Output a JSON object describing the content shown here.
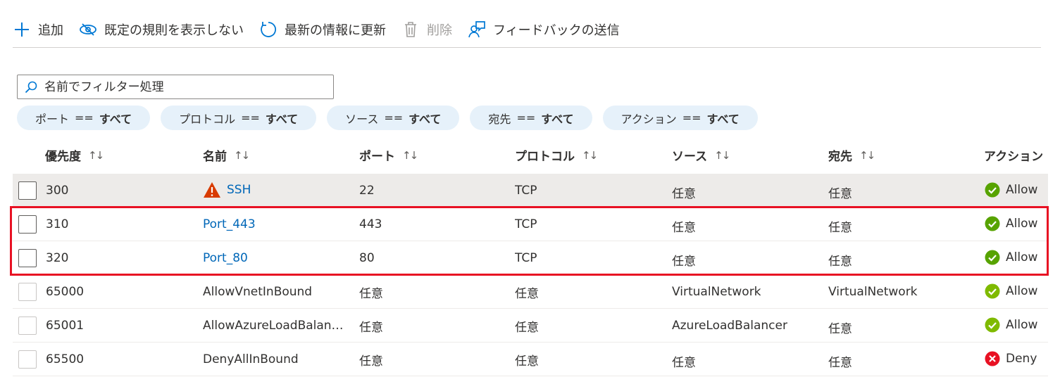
{
  "toolbar": {
    "add": "追加",
    "hide_default": "既定の規則を表示しない",
    "refresh": "最新の情報に更新",
    "delete": "削除",
    "feedback": "フィードバックの送信"
  },
  "filter": {
    "placeholder": "名前でフィルター処理"
  },
  "pills": [
    {
      "key": "ポート",
      "op": "==",
      "value": "すべて"
    },
    {
      "key": "プロトコル",
      "op": "==",
      "value": "すべて"
    },
    {
      "key": "ソース",
      "op": "==",
      "value": "すべて"
    },
    {
      "key": "宛先",
      "op": "==",
      "value": "すべて"
    },
    {
      "key": "アクション",
      "op": "==",
      "value": "すべて"
    }
  ],
  "table": {
    "columns": [
      "優先度",
      "名前",
      "ポート",
      "プロトコル",
      "ソース",
      "宛先",
      "アクション"
    ],
    "sort_glyph": "↑↓",
    "rows": [
      {
        "priority": "300",
        "name": "SSH",
        "port": "22",
        "protocol": "TCP",
        "source": "任意",
        "dest": "任意",
        "action": "Allow"
      },
      {
        "priority": "310",
        "name": "Port_443",
        "port": "443",
        "protocol": "TCP",
        "source": "任意",
        "dest": "任意",
        "action": "Allow"
      },
      {
        "priority": "320",
        "name": "Port_80",
        "port": "80",
        "protocol": "TCP",
        "source": "任意",
        "dest": "任意",
        "action": "Allow"
      },
      {
        "priority": "65000",
        "name": "AllowVnetInBound",
        "port": "任意",
        "protocol": "任意",
        "source": "VirtualNetwork",
        "dest": "VirtualNetwork",
        "action": "Allow"
      },
      {
        "priority": "65001",
        "name": "AllowAzureLoadBalan…",
        "port": "任意",
        "protocol": "任意",
        "source": "AzureLoadBalancer",
        "dest": "任意",
        "action": "Allow"
      },
      {
        "priority": "65500",
        "name": "DenyAllInBound",
        "port": "任意",
        "protocol": "任意",
        "source": "任意",
        "dest": "任意",
        "action": "Deny"
      }
    ]
  },
  "colors": {
    "accent": "#0078d4",
    "link": "#0067b8",
    "allow": "#57a300",
    "allow_light": "#7fba00",
    "deny": "#e81123",
    "warning": "#d83b01",
    "highlight": "#e81123"
  }
}
